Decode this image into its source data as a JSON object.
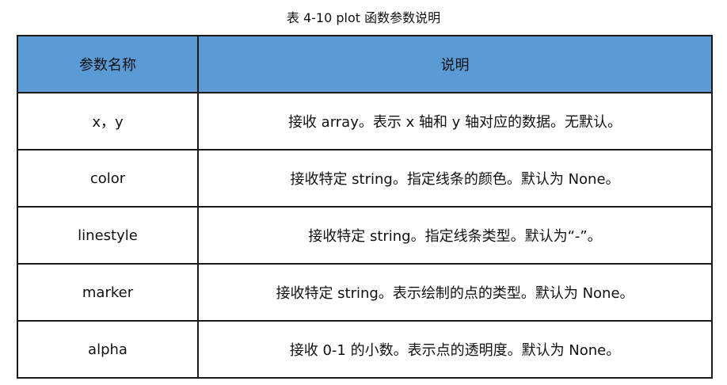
{
  "caption": "表 4-10 plot 函数参数说明",
  "table": {
    "headers": [
      "参数名称",
      "说明"
    ],
    "rows": [
      {
        "param": "x，y",
        "desc": "接收 array。表示 x 轴和 y 轴对应的数据。无默认。"
      },
      {
        "param": "color",
        "desc": "接收特定 string。指定线条的颜色。默认为 None。"
      },
      {
        "param": "linestyle",
        "desc": "接收特定 string。指定线条类型。默认为“-”。"
      },
      {
        "param": "marker",
        "desc": "接收特定 string。表示绘制的点的类型。默认为 None。"
      },
      {
        "param": "alpha",
        "desc": "接收 0-1 的小数。表示点的透明度。默认为 None。"
      }
    ]
  },
  "colors": {
    "header_bg": "#5b9bd5",
    "border": "#1a1a1a"
  }
}
